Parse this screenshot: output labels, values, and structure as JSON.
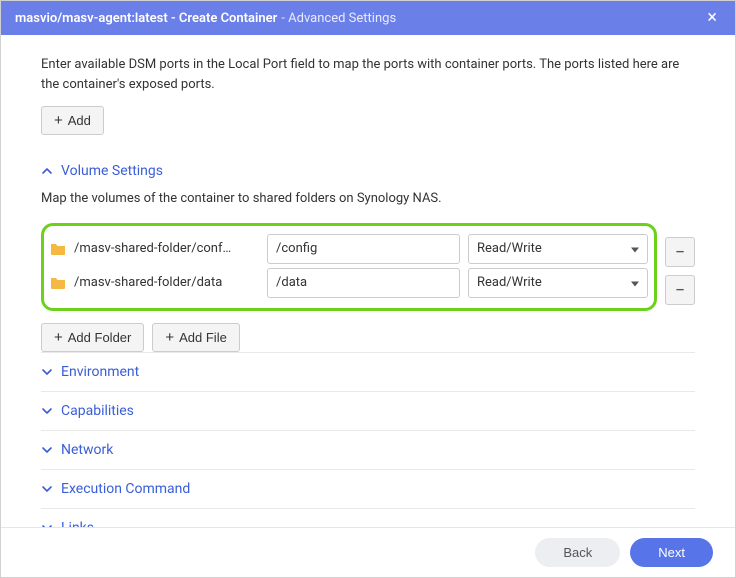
{
  "titlebar": {
    "main": "masvio/masv-agent:latest - Create Container",
    "sub": " - Advanced Settings"
  },
  "ports": {
    "description": "Enter available DSM ports in the Local Port field to map the ports with container ports. The ports listed here are the container's exposed ports.",
    "add_label": "Add"
  },
  "volume": {
    "title": "Volume Settings",
    "description": "Map the volumes of the container to shared folders on Synology NAS.",
    "rows": [
      {
        "host": "/masv-shared-folder/conf…",
        "mount": "/config",
        "perm": "Read/Write"
      },
      {
        "host": "/masv-shared-folder/data",
        "mount": "/data",
        "perm": "Read/Write"
      }
    ],
    "add_folder_label": "Add Folder",
    "add_file_label": "Add File"
  },
  "sections": {
    "environment": "Environment",
    "capabilities": "Capabilities",
    "network": "Network",
    "execution": "Execution Command",
    "links": "Links"
  },
  "footer": {
    "back": "Back",
    "next": "Next"
  }
}
